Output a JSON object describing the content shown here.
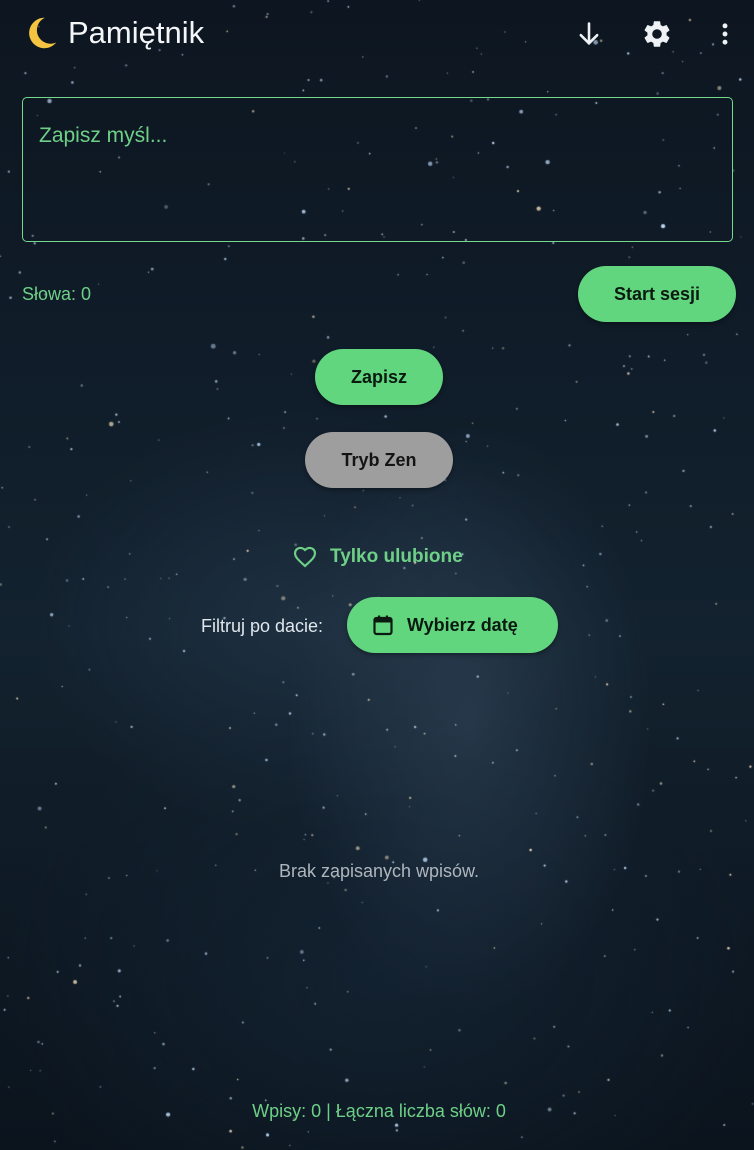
{
  "app": {
    "title": "Pamiętnik",
    "icons": [
      "moon-icon",
      "download-arrow-icon",
      "gear-icon",
      "more-vert-icon"
    ]
  },
  "editor": {
    "placeholder": "Zapisz myśl...",
    "value": ""
  },
  "word_count": "Słowa: 0",
  "buttons": {
    "start_session": "Start sesji",
    "save": "Zapisz",
    "zen_mode": "Tryb Zen",
    "pick_date": "Wybierz datę"
  },
  "favorites_toggle": {
    "label": "Tylko ulubione",
    "icon": "heart-outline-icon"
  },
  "filter": {
    "label": "Filtruj po dacie:",
    "icon": "calendar-icon"
  },
  "empty_message": "Brak zapisanych wpisów.",
  "stats": "Wpisy: 0 | Łączna liczba słów: 0",
  "colors": {
    "accent": "#62d67e",
    "accent_text": "#6ed087",
    "zen_button": "#9e9e9e",
    "background": "#101d2a"
  }
}
